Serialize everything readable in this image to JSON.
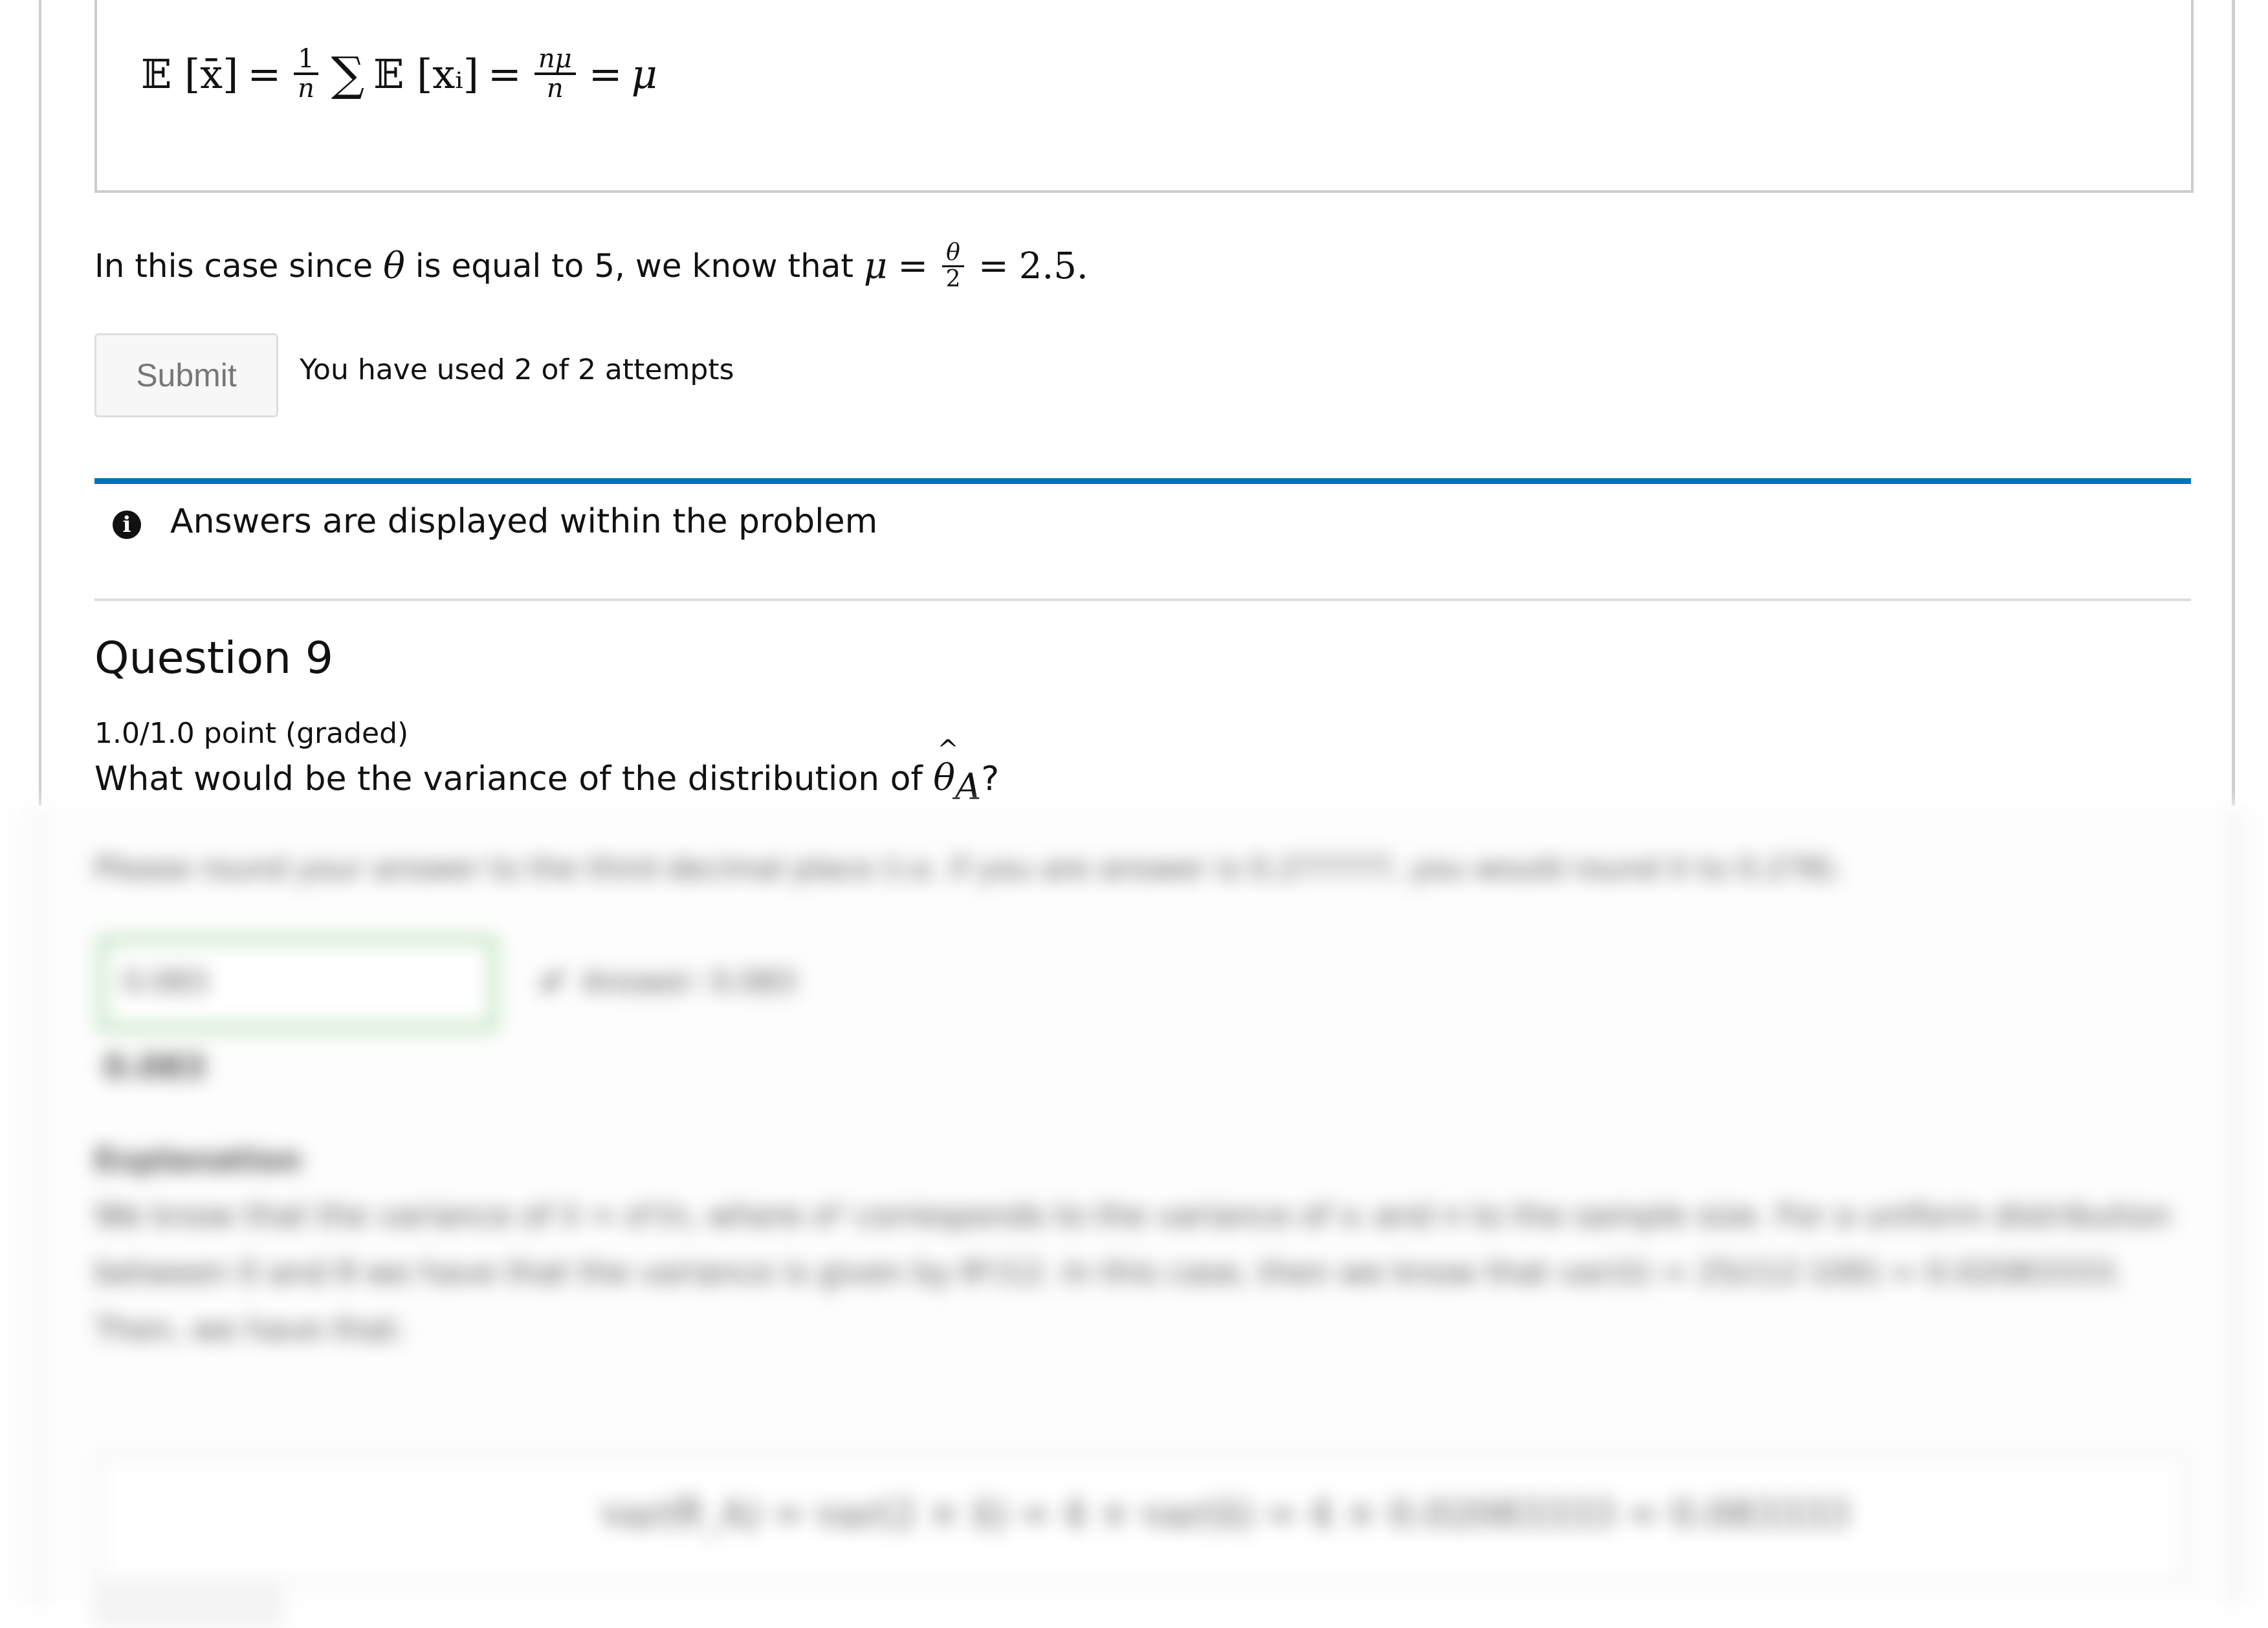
{
  "solution_equation": {
    "lhs": "𝔼 [x̄]",
    "eq1": "=",
    "frac1_num": "1",
    "frac1_den": "n",
    "sum": "∑",
    "term": "𝔼 [xᵢ]",
    "eq2": "=",
    "frac2_num": "nμ",
    "frac2_den": "n",
    "eq3": "=",
    "rhs": "μ"
  },
  "solution_text": {
    "prefix": "In this case since ",
    "theta": "θ",
    "middle": " is equal to 5, we know that ",
    "mu": "μ",
    "eq1": "=",
    "frac_num": "θ",
    "frac_den": "2",
    "eq2": "=",
    "result": "2.5."
  },
  "submit": {
    "label": "Submit",
    "attempts": "You have used 2 of 2 attempts"
  },
  "notice": {
    "icon": "info-circle-icon",
    "text": "Answers are displayed within the problem"
  },
  "question": {
    "title": "Question 9",
    "points": "1.0/1.0 point (graded)",
    "text_prefix": "What would be the variance of the distribution of ",
    "symbol": "θ",
    "subscript": "A",
    "suffix": "?"
  },
  "blurred": {
    "instructions": "Please round your answer to the third decimal place (i.e. if you are answer is 0.277777, you would round it to 0.278).",
    "input_value": "0.083",
    "status_icon": "check-icon",
    "answer_label": "Answer: 0.083",
    "preview": "0.083",
    "explanation_title": "Explanation",
    "explanation_text": "We know that the variance of x̄ = σ²/n, where σ² corresponds to the variance of xᵢ and n to the sample size. For a uniform distribution between 0 and θ we have that the variance is given by θ²/12. In this case, then we know that var(x̄) = 25/(12·100) = 0.02083333. Then, we have that:",
    "equation": "var(θ̂_A) = var(2 × x̄) = 4 × var(x̄) = 4 × 0.02083333 = 0.083333"
  }
}
